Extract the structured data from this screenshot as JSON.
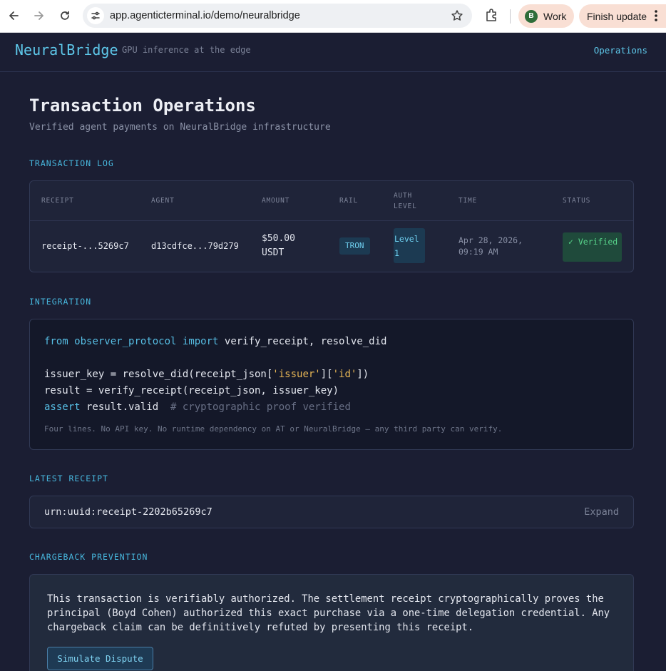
{
  "browser": {
    "url": "app.agenticterminal.io/demo/neuralbridge",
    "profile_initial": "B",
    "profile_name": "Work",
    "update_label": "Finish update"
  },
  "header": {
    "brand": "NeuralBridge",
    "tagline": "GPU inference at the edge",
    "nav_link": "Operations"
  },
  "page": {
    "title": "Transaction Operations",
    "subtitle": "Verified agent payments on NeuralBridge infrastructure"
  },
  "transaction_log": {
    "label": "TRANSACTION LOG",
    "columns": [
      "RECEIPT",
      "AGENT",
      "AMOUNT",
      "RAIL",
      "AUTH LEVEL",
      "TIME",
      "STATUS"
    ],
    "rows": [
      {
        "receipt": "receipt-...5269c7",
        "agent": "d13cdfce...79d279",
        "amount_value": "$50.00",
        "amount_currency": "USDT",
        "rail": "TRON",
        "auth_level": "Level 1",
        "time_date": "Apr 28, 2026,",
        "time_clock": "09:19 AM",
        "status": "✓ Verified"
      }
    ]
  },
  "integration": {
    "label": "INTEGRATION",
    "code": {
      "line1_from": "from",
      "line1_module": "observer_protocol",
      "line1_import": "import",
      "line1_rest": " verify_receipt, resolve_did",
      "line3_a": "issuer_key = resolve_did(receipt_json[",
      "line3_s1": "'issuer'",
      "line3_b": "][",
      "line3_s2": "'id'",
      "line3_c": "])",
      "line4": "result = verify_receipt(receipt_json, issuer_key)",
      "line5_kw": "assert",
      "line5_rest": " result.valid  ",
      "line5_comment": "# cryptographic proof verified"
    },
    "note": "Four lines. No API key. No runtime dependency on AT or NeuralBridge — any third party can verify."
  },
  "latest_receipt": {
    "label": "LATEST RECEIPT",
    "id": "urn:uuid:receipt-2202b65269c7",
    "expand_label": "Expand"
  },
  "chargeback": {
    "label": "CHARGEBACK PREVENTION",
    "text": "This transaction is verifiably authorized. The settlement receipt cryptographically proves the principal (Boyd Cohen) authorized this exact purchase via a one-time delegation credential. Any chargeback claim can be definitively refuted by presenting this receipt.",
    "button_label": "Simulate Dispute"
  },
  "colors": {
    "accent": "#5ec8ea",
    "background": "#1b1e33",
    "verified": "#59d68c"
  }
}
